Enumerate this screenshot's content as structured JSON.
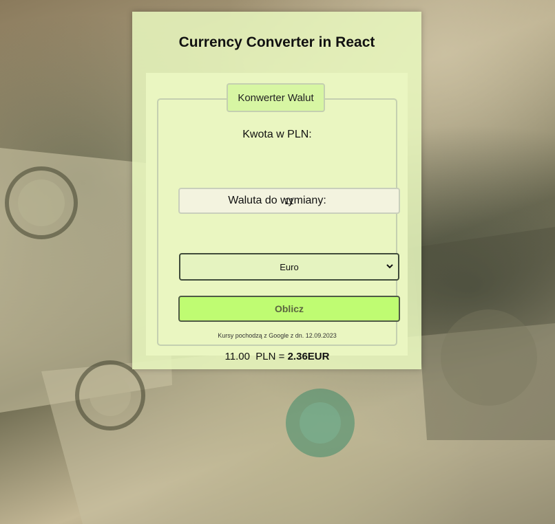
{
  "app": {
    "title": "Currency Converter in React"
  },
  "converter": {
    "legend": "Konwerter Walut",
    "amount_label": "Kwota w PLN:",
    "amount_value": "11",
    "currency_label": "Waluta do wymiany:",
    "currency_selected": "Euro",
    "calculate_label": "Oblicz",
    "source_note": "Kursy pochodzą z Google z dn. 12.09.2023"
  },
  "result": {
    "amount": "11.00",
    "from_currency": "PLN",
    "equals": "=",
    "converted": "2.36EUR"
  },
  "colors": {
    "card_bg": "#e8f7be",
    "button_bg": "#bffc72",
    "legend_bg": "#d7f6a3"
  }
}
